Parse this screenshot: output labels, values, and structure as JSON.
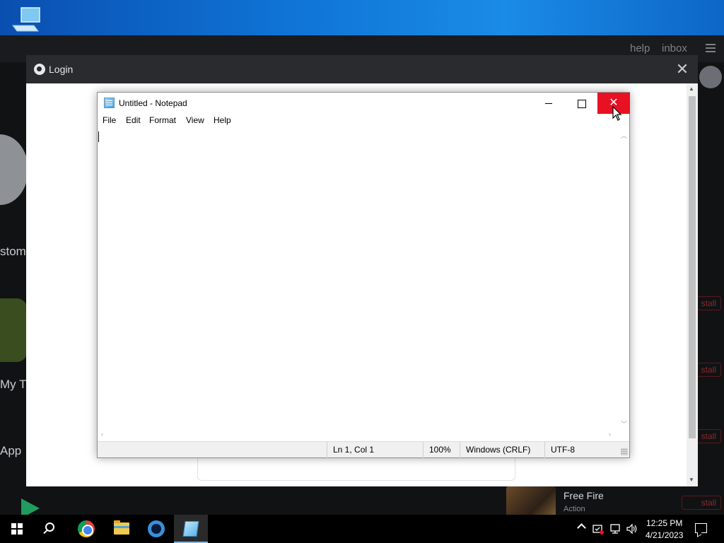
{
  "store": {
    "links": [
      "help",
      "inbox"
    ],
    "side_texts": [
      "stom",
      "My T",
      "App"
    ],
    "install_label": "stall",
    "game": {
      "title": "Free Fire",
      "genre": "Action"
    }
  },
  "login_dialog": {
    "title": "Login",
    "close_glyph": "✕"
  },
  "notepad": {
    "title": "Untitled - Notepad",
    "close_glyph": "✕",
    "menu": [
      "File",
      "Edit",
      "Format",
      "View",
      "Help"
    ],
    "content": "",
    "status": {
      "position": "Ln 1, Col 1",
      "zoom": "100%",
      "line_ending": "Windows (CRLF)",
      "encoding": "UTF-8"
    }
  },
  "taskbar": {
    "clock_time": "12:25 PM",
    "clock_date": "4/21/2023",
    "pinned": [
      "windows-start",
      "search",
      "chrome",
      "file-explorer",
      "app-store",
      "notepad"
    ]
  },
  "colors": {
    "close_hover": "#e81123",
    "taskbar": "#000000",
    "desktop": "#0f74d6"
  }
}
